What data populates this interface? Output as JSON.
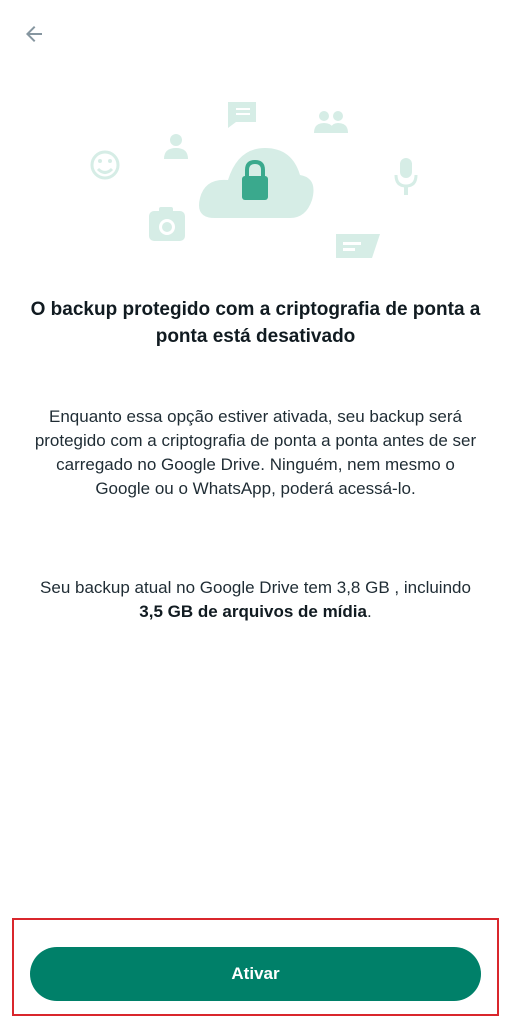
{
  "screen": {
    "title": "O backup protegido com a criptografia de ponta a ponta está desativado",
    "description": "Enquanto essa opção estiver ativada, seu backup será protegido com a criptografia de ponta a ponta antes de ser carregado no Google Drive. Ninguém, nem mesmo o Google ou o WhatsApp, poderá acessá-lo.",
    "size_prefix": "Seu backup atual no Google Drive tem 3,8 GB , incluindo ",
    "size_media": "3,5 GB de arquivos de mídia",
    "size_suffix": "."
  },
  "actions": {
    "activate_label": "Ativar"
  },
  "icons": {
    "back": "arrow-back-icon",
    "lock": "lock-icon",
    "cloud": "cloud-icon"
  },
  "colors": {
    "accent": "#008069",
    "illustration_tint": "#d6ede6",
    "illustration_dark": "#3aa98d",
    "highlight_border": "#d9262c"
  }
}
